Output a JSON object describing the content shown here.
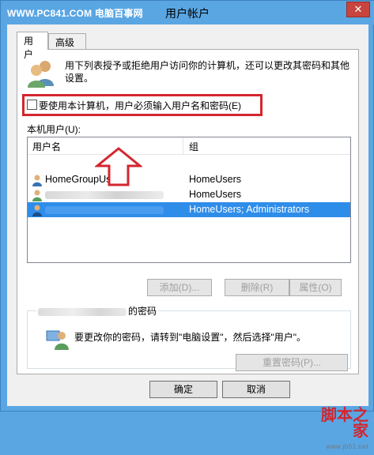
{
  "titlebar": {
    "watermark": "WWW.PC841.COM 电脑百事网",
    "title": "用户帐户",
    "close_glyph": "✕"
  },
  "tabs": [
    {
      "label": "用户",
      "active": true
    },
    {
      "label": "高级",
      "active": false
    }
  ],
  "description": "用下列表授予或拒绝用户访问你的计算机，还可以更改其密码和其他设置。",
  "require_login": {
    "label": "要使用本计算机，用户必须输入用户名和密码(E)",
    "checked": false
  },
  "annotation": {
    "highlight_color": "#d3262f"
  },
  "users_list": {
    "label": "本机用户(U):",
    "columns": [
      "用户名",
      "组"
    ],
    "rows": [
      {
        "user": "HomeGroupUser$",
        "group": "HomeUsers",
        "selected": false
      },
      {
        "user": "",
        "group": "HomeUsers",
        "selected": false
      },
      {
        "user": "",
        "group": "HomeUsers; Administrators",
        "selected": true
      }
    ]
  },
  "list_buttons": {
    "add": "添加(D)...",
    "remove": "删除(R)",
    "properties": "属性(O)"
  },
  "password_group": {
    "title_suffix": "的密码",
    "text": "要更改你的密码，请转到\"电脑设置\"，然后选择\"用户\"。",
    "reset_button": "重置密码(P)..."
  },
  "dialog_buttons": {
    "ok": "确定",
    "cancel": "取消"
  },
  "footer_watermark": {
    "main": "脚本之家",
    "sub": "www.jb51.net"
  },
  "colors": {
    "accent": "#5aa6e3",
    "selection": "#2f8dea",
    "close": "#c7453e"
  }
}
